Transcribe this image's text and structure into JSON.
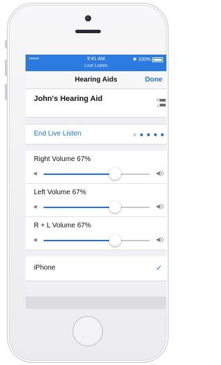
{
  "status_bar": {
    "signal": "•••••",
    "time": "9:41 AM",
    "subtitle": "Live Listen",
    "battery": "100%"
  },
  "nav": {
    "title": "Hearing Aids",
    "done": "Done"
  },
  "device": {
    "name": "John's Hearing Aid",
    "right_label": "R",
    "left_label": "L"
  },
  "live_listen": {
    "label": "End Live Listen"
  },
  "volumes": [
    {
      "label": "Right Volume  67%",
      "value": 0.67
    },
    {
      "label": "Left Volume  67%",
      "value": 0.67
    },
    {
      "label": "R + L Volume  67%",
      "value": 0.67
    }
  ],
  "source": {
    "label": "iPhone",
    "selected": true
  },
  "colors": {
    "accent": "#1a73e8",
    "status_bar": "#2b7be0"
  }
}
